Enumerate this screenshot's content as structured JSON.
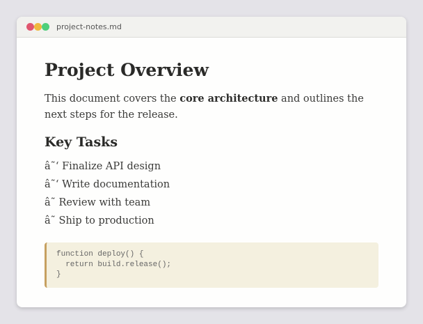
{
  "window": {
    "filename": "project-notes.md",
    "dot_colors": [
      "#e0566f",
      "#f0b93e",
      "#4fcf7b"
    ]
  },
  "document": {
    "title": "Project Overview",
    "intro_before": "This document covers the ",
    "intro_bold": "core architecture",
    "intro_after": " and outlines the next steps for the release.",
    "section_heading": "Key Tasks",
    "tasks": [
      {
        "glyph": "â˜‘",
        "text": "Finalize API design"
      },
      {
        "glyph": "â˜‘",
        "text": "Write documentation"
      },
      {
        "glyph": "â˜",
        "text": "Review with team"
      },
      {
        "glyph": "â˜",
        "text": "Ship to production"
      }
    ],
    "code_lines": [
      "function deploy() {",
      "  return build.release();",
      "}"
    ]
  }
}
